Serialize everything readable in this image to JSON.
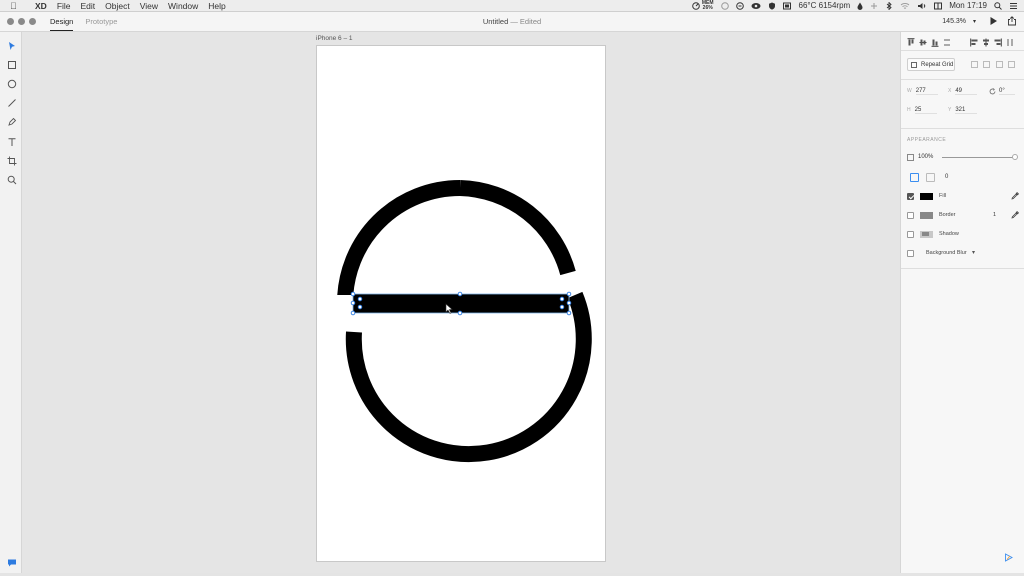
{
  "menubar": {
    "app_name": "XD",
    "menus": [
      "File",
      "Edit",
      "Object",
      "View",
      "Window",
      "Help"
    ],
    "mem_line1": "MEM",
    "mem_line2": "26%",
    "temp": "66°C 6154rpm",
    "clock": "Mon 17:19"
  },
  "toolbar": {
    "tab_design": "Design",
    "tab_prototype": "Prototype",
    "doc_name": "Untitled",
    "doc_status": " — Edited",
    "zoom": "145.3%"
  },
  "canvas": {
    "artboard_name": "iPhone 6 – 1"
  },
  "properties": {
    "repeat_grid": "Repeat Grid",
    "w_label": "W",
    "w_value": "277",
    "x_label": "X",
    "x_value": "49",
    "rotation": "0°",
    "h_label": "H",
    "h_value": "25",
    "y_label": "Y",
    "y_value": "321",
    "appearance_title": "APPEARANCE",
    "opacity": "100%",
    "corner_radius": "0",
    "fill_label": "Fill",
    "fill_color": "#000000",
    "fill_checked": true,
    "border_label": "Border",
    "border_color": "#888888",
    "border_width": "1",
    "shadow_label": "Shadow",
    "bgblur_label": "Background Blur"
  }
}
